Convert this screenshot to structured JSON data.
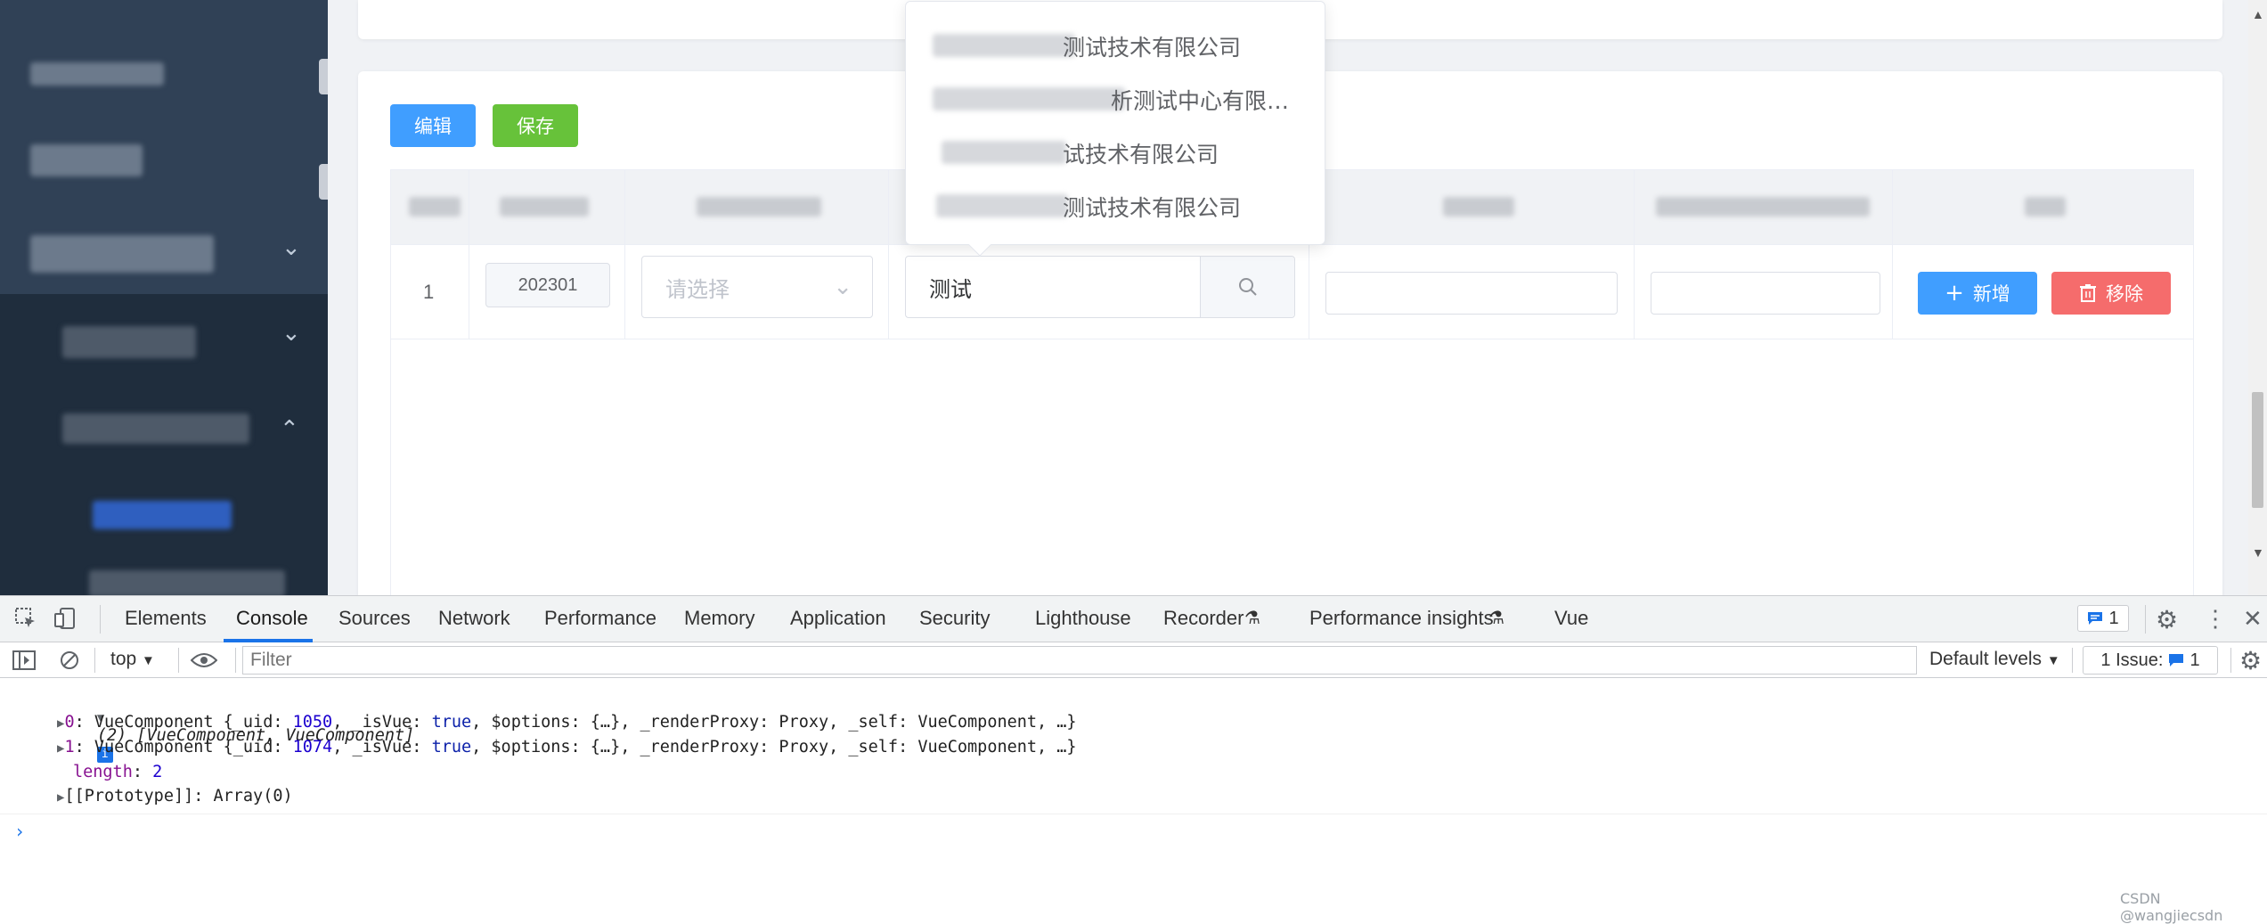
{
  "app": {
    "buttons": {
      "edit": "编辑",
      "save": "保存"
    },
    "table": {
      "row": {
        "index": "1",
        "code": "202301",
        "select_placeholder": "请选择",
        "search_value": "测试",
        "add": "新增",
        "remove": "移除"
      }
    },
    "dropdown": {
      "items": [
        "测试技术有限公司",
        "析测试中心有限…",
        "试技术有限公司",
        "测试技术有限公司"
      ]
    }
  },
  "devtools": {
    "tabs": [
      "Elements",
      "Console",
      "Sources",
      "Network",
      "Performance",
      "Memory",
      "Application",
      "Security",
      "Lighthouse",
      "Recorder",
      "Performance insights",
      "Vue"
    ],
    "active_tab": "Console",
    "message_badge": "1",
    "context": "top",
    "filter_placeholder": "Filter",
    "levels": "Default levels",
    "issues_label": "1 Issue:",
    "issues_count": "1",
    "source_link": "d03-table.vue?7de2:231",
    "log": {
      "summary": "(2) [VueComponent, VueComponent]",
      "item0": {
        "key": "0",
        "uid": "1050"
      },
      "item1": {
        "key": "1",
        "uid": "1074"
      },
      "length_key": "length",
      "length_value": "2",
      "proto": "[[Prototype]]: Array(0)"
    },
    "watermark": "CSDN @wangjiecsdn"
  }
}
